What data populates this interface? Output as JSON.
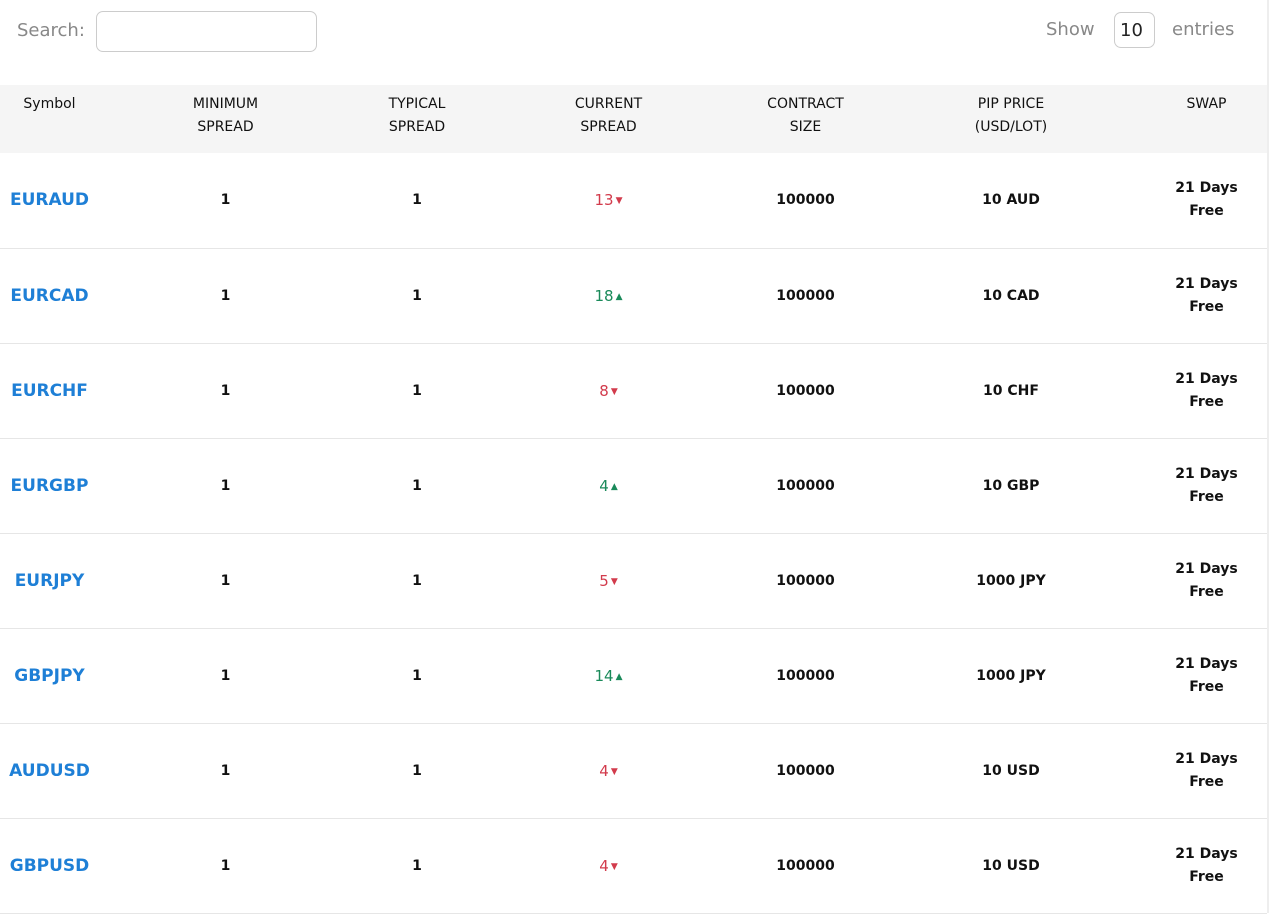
{
  "search": {
    "label": "Search:",
    "value": "",
    "placeholder": ""
  },
  "length": {
    "show_label": "Show",
    "value": "10",
    "entries_label": "entries"
  },
  "colors": {
    "link": "#1e7fd6",
    "down": "#d23b4c",
    "up": "#1a8a5a",
    "header_bg": "#f5f5f5"
  },
  "table": {
    "headers": [
      {
        "key": "symbol",
        "lines": [
          "Symbol"
        ]
      },
      {
        "key": "min_spread",
        "lines": [
          "MINIMUM",
          "SPREAD"
        ]
      },
      {
        "key": "typical_spread",
        "lines": [
          "TYPICAL",
          "SPREAD"
        ]
      },
      {
        "key": "current_spread",
        "lines": [
          "CURRENT",
          "SPREAD"
        ]
      },
      {
        "key": "contract_size",
        "lines": [
          "CONTRACT",
          "SIZE"
        ]
      },
      {
        "key": "pip_price",
        "lines": [
          "PIP PRICE",
          "(USD/LOT)"
        ]
      },
      {
        "key": "swap",
        "lines": [
          "SWAP"
        ]
      }
    ],
    "rows": [
      {
        "symbol": "EURAUD",
        "min": "1",
        "typical": "1",
        "current": "13",
        "trend": "down",
        "trend_icon": "caret-down-icon",
        "contract": "100000",
        "pip": "10 AUD",
        "swap": [
          "21 Days",
          "Free"
        ]
      },
      {
        "symbol": "EURCAD",
        "min": "1",
        "typical": "1",
        "current": "18",
        "trend": "up",
        "trend_icon": "caret-up-icon",
        "contract": "100000",
        "pip": "10 CAD",
        "swap": [
          "21 Days",
          "Free"
        ]
      },
      {
        "symbol": "EURCHF",
        "min": "1",
        "typical": "1",
        "current": "8",
        "trend": "down",
        "trend_icon": "caret-down-icon",
        "contract": "100000",
        "pip": "10 CHF",
        "swap": [
          "21 Days",
          "Free"
        ]
      },
      {
        "symbol": "EURGBP",
        "min": "1",
        "typical": "1",
        "current": "4",
        "trend": "up",
        "trend_icon": "caret-up-icon",
        "contract": "100000",
        "pip": "10 GBP",
        "swap": [
          "21 Days",
          "Free"
        ]
      },
      {
        "symbol": "EURJPY",
        "min": "1",
        "typical": "1",
        "current": "5",
        "trend": "down",
        "trend_icon": "caret-down-icon",
        "contract": "100000",
        "pip": "1000 JPY",
        "swap": [
          "21 Days",
          "Free"
        ]
      },
      {
        "symbol": "GBPJPY",
        "min": "1",
        "typical": "1",
        "current": "14",
        "trend": "up",
        "trend_icon": "caret-up-icon",
        "contract": "100000",
        "pip": "1000 JPY",
        "swap": [
          "21 Days",
          "Free"
        ]
      },
      {
        "symbol": "AUDUSD",
        "min": "1",
        "typical": "1",
        "current": "4",
        "trend": "down",
        "trend_icon": "caret-down-icon",
        "contract": "100000",
        "pip": "10 USD",
        "swap": [
          "21 Days",
          "Free"
        ]
      },
      {
        "symbol": "GBPUSD",
        "min": "1",
        "typical": "1",
        "current": "4",
        "trend": "down",
        "trend_icon": "caret-down-icon",
        "contract": "100000",
        "pip": "10 USD",
        "swap": [
          "21 Days",
          "Free"
        ]
      }
    ]
  }
}
